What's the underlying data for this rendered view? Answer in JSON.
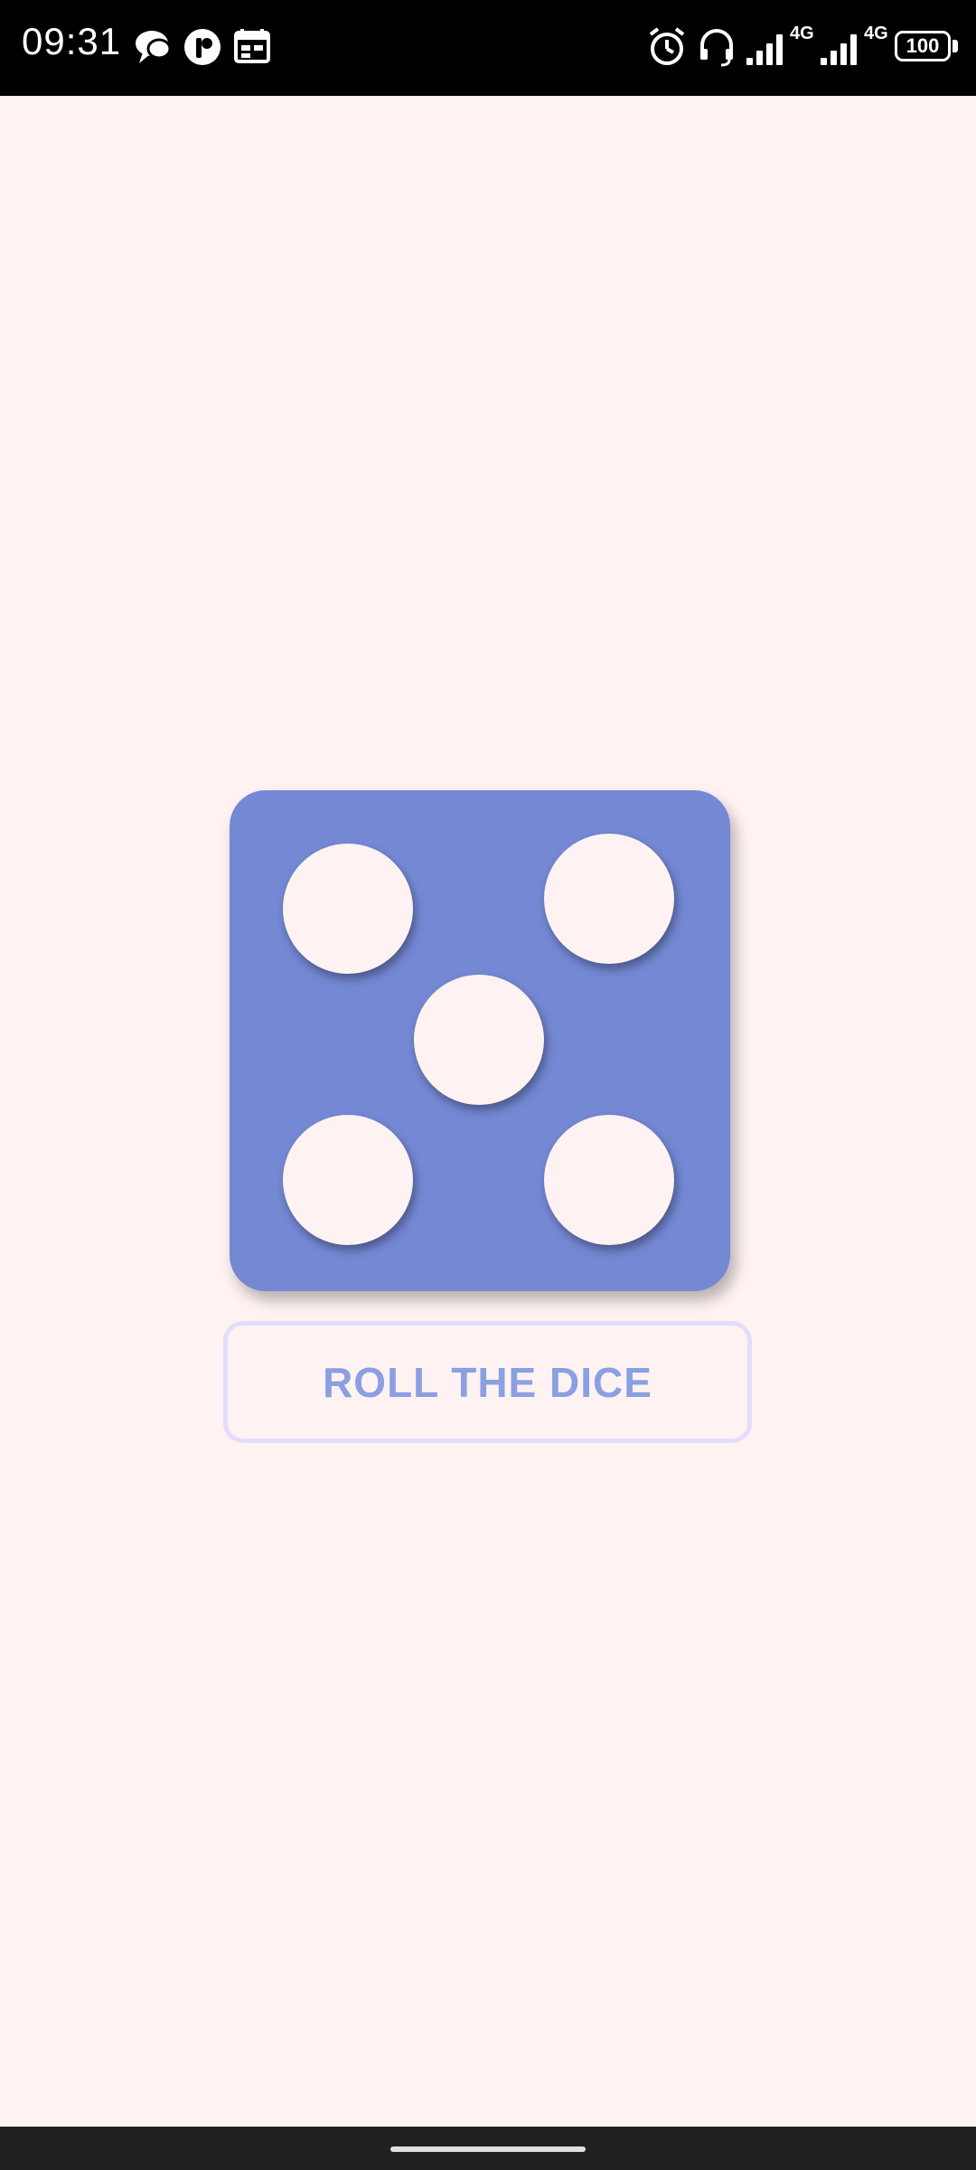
{
  "status_bar": {
    "time": "09:31",
    "left_icons": [
      "chat-bubble-icon",
      "app-badge-icon",
      "calendar-icon"
    ],
    "right_icons": [
      "alarm-icon",
      "headset-icon",
      "signal-icon",
      "signal-icon"
    ],
    "network_1": "4G",
    "network_2": "4G",
    "battery": "100"
  },
  "dice": {
    "face_value": 5,
    "color": "#7488D4",
    "pip_color": "#FEF2F2"
  },
  "roll_button": {
    "label": "ROLL THE DICE",
    "text_color": "#8AA0E0",
    "border_color": "#E2DEFB"
  },
  "colors": {
    "background": "#FEF2F2"
  }
}
